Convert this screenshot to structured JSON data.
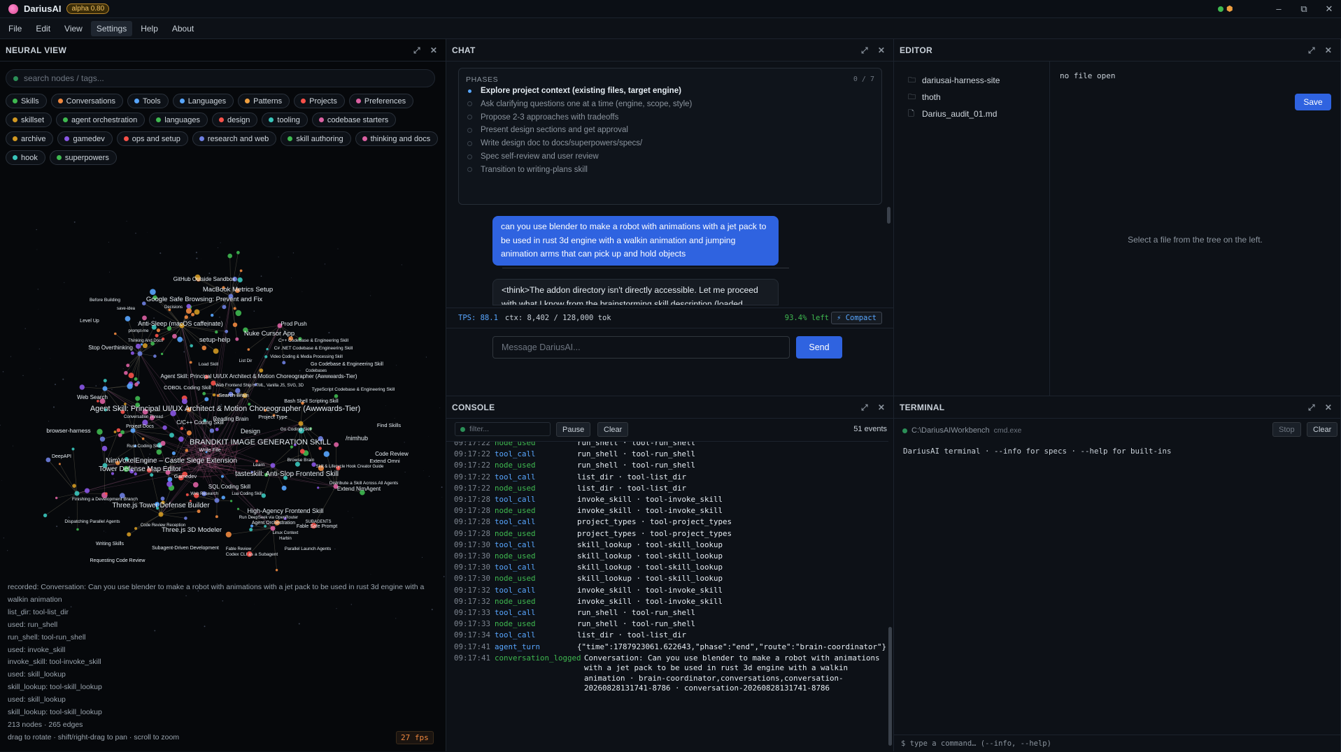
{
  "app": {
    "name": "DariusAI",
    "badge": "alpha 0.80"
  },
  "menu": [
    "File",
    "Edit",
    "View",
    "Settings",
    "Help",
    "About"
  ],
  "colors": {
    "accent": "#2f63e0",
    "green": "#3fb950",
    "blue": "#58a6ff",
    "bg": "#0d1117"
  },
  "neural": {
    "title": "NEURAL VIEW",
    "search_placeholder": "search nodes / tags...",
    "tags": [
      {
        "label": "Skills",
        "color": "#3fb950"
      },
      {
        "label": "Conversations",
        "color": "#f0883e"
      },
      {
        "label": "Tools",
        "color": "#58a6ff"
      },
      {
        "label": "Languages",
        "color": "#58a6ff"
      },
      {
        "label": "Patterns",
        "color": "#f0a040"
      },
      {
        "label": "Projects",
        "color": "#f85149"
      },
      {
        "label": "Preferences",
        "color": "#db61a2"
      },
      {
        "label": "skillset",
        "color": "#d29922"
      },
      {
        "label": "agent orchestration",
        "color": "#3fb950"
      },
      {
        "label": "languages",
        "color": "#3fb950"
      },
      {
        "label": "design",
        "color": "#f85149"
      },
      {
        "label": "tooling",
        "color": "#39c5bb"
      },
      {
        "label": "codebase starters",
        "color": "#db61a2"
      },
      {
        "label": "archive",
        "color": "#d29922"
      },
      {
        "label": "gamedev",
        "color": "#8957e5"
      },
      {
        "label": "ops and setup",
        "color": "#f85149"
      },
      {
        "label": "research and web",
        "color": "#6e7fe0"
      },
      {
        "label": "skill authoring",
        "color": "#3fb950"
      },
      {
        "label": "thinking and docs",
        "color": "#db61a2"
      },
      {
        "label": "hook",
        "color": "#39c5bb"
      },
      {
        "label": "superpowers",
        "color": "#3fb950"
      }
    ],
    "graph_labels": [
      "GitHub Outside Sandbox",
      "MacBook Metrics Setup",
      "Google Safe Browsing: Prevent and Fix",
      "Before Building",
      "save-idea",
      "Decisions",
      "Level Up",
      "Anti-Sleep (macOS caffeinate)",
      "prompt-me",
      "Prod Push",
      "Nuke Cursor App",
      "setup-help",
      "Thinking And Docs",
      "Stop Overthinking",
      "C++ Codebase & Engineering Skill",
      "C# .NET Codebase & Engineering Skill",
      "Video Coding & Media Processing Skill",
      "Load Skill",
      "List Dir",
      "Go Codebase & Engineering Skill",
      "TypeScript Codebase & Engineering Skill",
      "Codebases",
      "Agent Skill: Principal UI/UX Architect & Motion Choreographer (Awwwards-Tier)",
      "COBOL Coding Skill",
      "Web Frontend Ship HTML, Vanilla JS, SVG, 3D",
      "Search Brain",
      "Bash Shell Scripting Skill",
      "Web Search",
      "Agent Skill: Principal UI/UX Architect & Motion Choreographer (Awwwards-Tier)",
      "Project Type",
      "Conversation Thread",
      "C/C++ Coding Skill",
      "Reading Brain",
      "Project Docs",
      "Design",
      "Go Coding Skill",
      "Find Skills",
      "browser-harness",
      "/nimhub",
      "BRANDKIT IMAGE GENERATION SKILL",
      "Rust Coding Skill",
      "Write File",
      "Code Review",
      "DeepAPI",
      "NimVoxelEngine – Castle Siege Extension",
      "Browse Brain",
      "Extend Omni",
      "Tower Defense Map Editor",
      "Learn",
      "Skill & Lifecycle Hook Creator Guide",
      "tasteskill: Anti-Slop Frontend Skill",
      "Gamedev",
      "Distribute a Skill Across All Agents",
      "Extend NimAgent",
      "SQL Coding Skill",
      "Web Research",
      "Lua Coding Skill",
      "Finishing a Development Branch",
      "Three.js Tower Defense Builder",
      "High-Agency Frontend Skill",
      "Run DeepSeek via OpenRouter",
      "Agent Orchestration",
      "SUBAGENTS",
      "Dispatching Parallel Agents",
      "Code Review Reception",
      "Fable Safe Prompt",
      "Three.js 3D Modeler",
      "Linux Context",
      "Harbin",
      "Writing Skills",
      "Subagent-Driven Development",
      "Fable Review",
      "Codex CLI as a Subagent",
      "Parallel Launch Agents",
      "Requesting Code Review"
    ],
    "log": [
      "recorded: Conversation: Can you use blender to make a robot with animations with a jet pack to be used in rust 3d engine with a",
      "walkin animation",
      "list_dir: tool-list_dir",
      "used: run_shell",
      "run_shell: tool-run_shell",
      "used: invoke_skill",
      "invoke_skill: tool-invoke_skill",
      "used: skill_lookup",
      "skill_lookup: tool-skill_lookup",
      "used: skill_lookup",
      "skill_lookup: tool-skill_lookup",
      "213 nodes · 265 edges",
      "drag to rotate · shift/right-drag to pan · scroll to zoom"
    ],
    "fps": "27 fps"
  },
  "chat": {
    "title": "CHAT",
    "phases_title": "PHASES",
    "phases_count": "0 / 7",
    "phases": [
      "Explore project context (existing files, target engine)",
      "Ask clarifying questions one at a time (engine, scope, style)",
      "Propose 2-3 approaches with tradeoffs",
      "Present design sections and get approval",
      "Write design doc to docs/superpowers/specs/",
      "Spec self-review and user review",
      "Transition to writing-plans skill"
    ],
    "user_message": "can you use blender to make a robot with animations with a jet pack to be used in rust 3d engine with a walkin animation and jumping animation arms that can pick up and hold objects",
    "assistant_message": "<think>The addon directory isn't directly accessible. Let me proceed with what I know from the brainstorming skill description (loaded earlier). Key principles from",
    "tps": "TPS: 88.1",
    "ctx": "ctx: 8,402 / 128,000 tok",
    "left": "93.4% left",
    "compact": "⚡ Compact",
    "input_placeholder": "Message DariusAI...",
    "send": "Send"
  },
  "editor": {
    "title": "EDITOR",
    "tree": [
      {
        "name": "dariusai-harness-site",
        "type": "folder"
      },
      {
        "name": "thoth",
        "type": "folder"
      },
      {
        "name": "Darius_audit_01.md",
        "type": "file"
      }
    ],
    "no_file": "no file open",
    "save": "Save",
    "empty": "Select a file from the tree on the left."
  },
  "console": {
    "title": "CONSOLE",
    "filter_placeholder": "filter...",
    "pause": "Pause",
    "clear": "Clear",
    "events": "51 events",
    "rows": [
      {
        "time": "09:17:22",
        "event": "node_used",
        "kind": "used",
        "detail": "run_shell · tool-run_shell"
      },
      {
        "time": "09:17:22",
        "event": "tool_call",
        "kind": "call",
        "detail": "run_shell · tool-run_shell"
      },
      {
        "time": "09:17:22",
        "event": "node_used",
        "kind": "used",
        "detail": "run_shell · tool-run_shell"
      },
      {
        "time": "09:17:22",
        "event": "tool_call",
        "kind": "call",
        "detail": "list_dir · tool-list_dir"
      },
      {
        "time": "09:17:22",
        "event": "node_used",
        "kind": "used",
        "detail": "list_dir · tool-list_dir"
      },
      {
        "time": "09:17:28",
        "event": "tool_call",
        "kind": "call",
        "detail": "invoke_skill · tool-invoke_skill"
      },
      {
        "time": "09:17:28",
        "event": "node_used",
        "kind": "used",
        "detail": "invoke_skill · tool-invoke_skill"
      },
      {
        "time": "09:17:28",
        "event": "tool_call",
        "kind": "call",
        "detail": "project_types · tool-project_types"
      },
      {
        "time": "09:17:28",
        "event": "node_used",
        "kind": "used",
        "detail": "project_types · tool-project_types"
      },
      {
        "time": "09:17:30",
        "event": "tool_call",
        "kind": "call",
        "detail": "skill_lookup · tool-skill_lookup"
      },
      {
        "time": "09:17:30",
        "event": "node_used",
        "kind": "used",
        "detail": "skill_lookup · tool-skill_lookup"
      },
      {
        "time": "09:17:30",
        "event": "tool_call",
        "kind": "call",
        "detail": "skill_lookup · tool-skill_lookup"
      },
      {
        "time": "09:17:30",
        "event": "node_used",
        "kind": "used",
        "detail": "skill_lookup · tool-skill_lookup"
      },
      {
        "time": "09:17:32",
        "event": "tool_call",
        "kind": "call",
        "detail": "invoke_skill · tool-invoke_skill"
      },
      {
        "time": "09:17:32",
        "event": "node_used",
        "kind": "used",
        "detail": "invoke_skill · tool-invoke_skill"
      },
      {
        "time": "09:17:33",
        "event": "tool_call",
        "kind": "call",
        "detail": "run_shell · tool-run_shell"
      },
      {
        "time": "09:17:33",
        "event": "node_used",
        "kind": "used",
        "detail": "run_shell · tool-run_shell"
      },
      {
        "time": "09:17:34",
        "event": "tool_call",
        "kind": "call",
        "detail": "list_dir · tool-list_dir"
      },
      {
        "time": "09:17:41",
        "event": "agent_turn",
        "kind": "turn",
        "detail": "{\"time\":1787923061.622643,\"phase\":\"end\",\"route\":\"brain-coordinator\"}"
      },
      {
        "time": "09:17:41",
        "event": "conversation_logged",
        "kind": "logged",
        "detail": "Conversation: Can you use blender to make a robot with animations"
      }
    ],
    "logged_cont": [
      "with a jet pack to be used in rust 3d engine with a walkin",
      "animation · brain-coordinator,conversations,conversation-",
      "20260828131741-8786 · conversation-20260828131741-8786"
    ]
  },
  "terminal": {
    "title": "TERMINAL",
    "path": "C:\\DariusAIWorkbench",
    "shell": "cmd.exe",
    "stop": "Stop",
    "clear": "Clear",
    "output": "DariusAI terminal · --info for specs · --help for built-ins",
    "input_placeholder": "$ type a command… (--info, --help)"
  }
}
